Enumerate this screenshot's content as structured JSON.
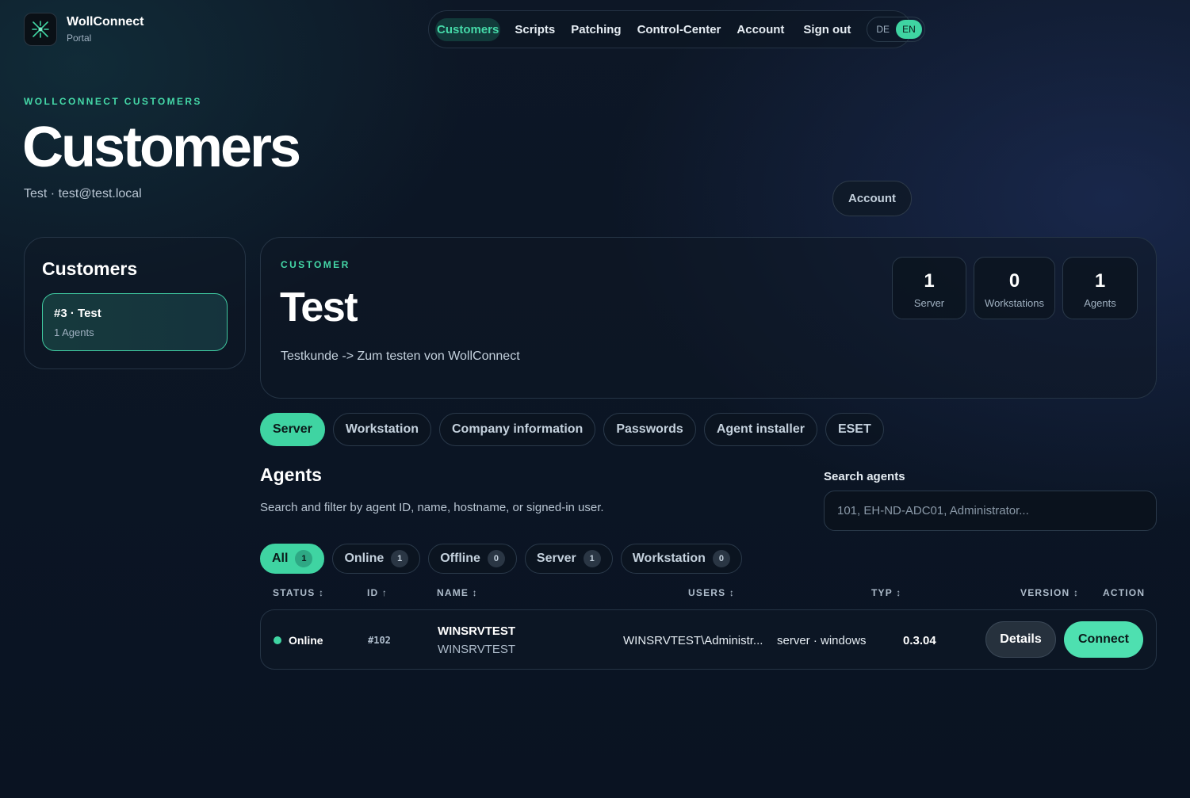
{
  "brand": {
    "name": "WollConnect",
    "subtitle": "Portal"
  },
  "nav": {
    "items": [
      "Customers",
      "Scripts",
      "Patching",
      "Control-Center",
      "Account",
      "Sign out"
    ],
    "active": "Customers",
    "languages": [
      "DE",
      "EN"
    ],
    "active_language": "EN"
  },
  "hero": {
    "eyebrow": "WOLLCONNECT CUSTOMERS",
    "title": "Customers",
    "subtitle": "Test · test@test.local",
    "account_button": "Account"
  },
  "sidebar": {
    "title": "Customers",
    "items": [
      {
        "label": "#3 · Test",
        "meta": "1 Agents"
      }
    ]
  },
  "customer": {
    "label": "CUSTOMER",
    "name": "Test",
    "description": "Testkunde -> Zum testen von WollConnect",
    "stats": [
      {
        "value": "1",
        "label": "Server"
      },
      {
        "value": "0",
        "label": "Workstations"
      },
      {
        "value": "1",
        "label": "Agents"
      }
    ]
  },
  "tabs": [
    "Server",
    "Workstation",
    "Company information",
    "Passwords",
    "Agent installer",
    "ESET"
  ],
  "agents": {
    "title": "Agents",
    "subtitle": "Search and filter by agent ID, name, hostname, or signed-in user.",
    "search_label": "Search agents",
    "search_placeholder": "101, EH-ND-ADC01, Administrator...",
    "filters": [
      {
        "label": "All",
        "count": "1"
      },
      {
        "label": "Online",
        "count": "1"
      },
      {
        "label": "Offline",
        "count": "0"
      },
      {
        "label": "Server",
        "count": "1"
      },
      {
        "label": "Workstation",
        "count": "0"
      }
    ],
    "columns": {
      "status": "STATUS ↕",
      "id": "ID ↑",
      "name": "NAME ↕",
      "users": "USERS ↕",
      "typ": "TYP ↕",
      "version": "VERSION ↕",
      "action": "ACTION"
    },
    "rows": [
      {
        "status": "Online",
        "id": "#102",
        "name": "WINSRVTEST",
        "hostname": "WINSRVTEST",
        "users": "WINSRVTEST\\Administr...",
        "typ": "server · windows",
        "version": "0.3.04",
        "details_label": "Details",
        "connect_label": "Connect"
      }
    ]
  },
  "colors": {
    "accent": "#3fd4a2",
    "background": "#0b1524"
  }
}
